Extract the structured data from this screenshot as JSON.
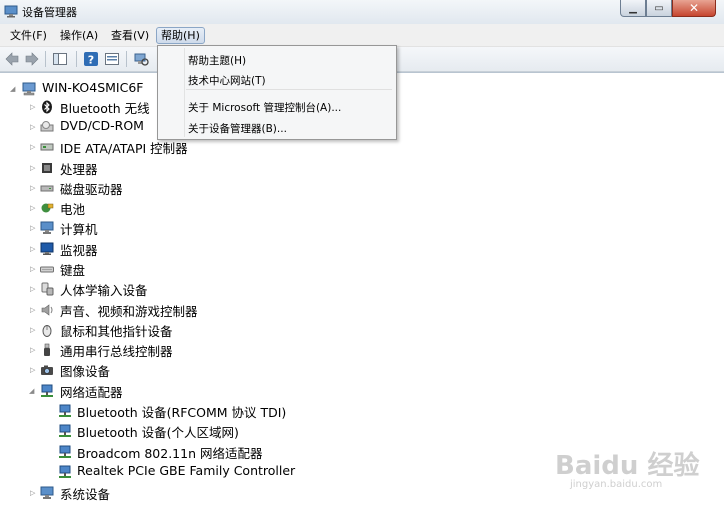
{
  "window": {
    "title": "设备管理器"
  },
  "menubar": {
    "items": [
      {
        "label": "文件(F)"
      },
      {
        "label": "操作(A)"
      },
      {
        "label": "查看(V)"
      },
      {
        "label": "帮助(H)"
      }
    ]
  },
  "help_menu": {
    "items": [
      {
        "label": "帮助主题(H)"
      },
      {
        "label": "技术中心网站(T)"
      },
      {
        "label": "关于 Microsoft 管理控制台(A)..."
      },
      {
        "label": "关于设备管理器(B)..."
      }
    ]
  },
  "tree": {
    "root": {
      "label": "WIN-KO4SMIC6F"
    },
    "categories": [
      {
        "label": "Bluetooth 无线",
        "icon": "bluetooth-icon"
      },
      {
        "label": "DVD/CD-ROM",
        "icon": "dvd-drive-icon"
      },
      {
        "label": "IDE ATA/ATAPI 控制器",
        "icon": "ide-controller-icon"
      },
      {
        "label": "处理器",
        "icon": "processor-icon"
      },
      {
        "label": "磁盘驱动器",
        "icon": "disk-drive-icon"
      },
      {
        "label": "电池",
        "icon": "battery-icon"
      },
      {
        "label": "计算机",
        "icon": "computer-icon"
      },
      {
        "label": "监视器",
        "icon": "monitor-icon"
      },
      {
        "label": "键盘",
        "icon": "keyboard-icon"
      },
      {
        "label": "人体学输入设备",
        "icon": "hid-icon"
      },
      {
        "label": "声音、视频和游戏控制器",
        "icon": "speaker-icon"
      },
      {
        "label": "鼠标和其他指针设备",
        "icon": "mouse-icon"
      },
      {
        "label": "通用串行总线控制器",
        "icon": "usb-icon"
      },
      {
        "label": "图像设备",
        "icon": "camera-icon"
      },
      {
        "label": "网络适配器",
        "icon": "network-adapter-icon"
      }
    ],
    "network_children": [
      {
        "label": "Bluetooth 设备(RFCOMM 协议 TDI)"
      },
      {
        "label": "Bluetooth 设备(个人区域网)"
      },
      {
        "label": "Broadcom 802.11n 网络适配器"
      },
      {
        "label": "Realtek PCIe GBE Family Controller"
      }
    ],
    "last": {
      "label": "系统设备",
      "icon": "system-devices-icon"
    }
  },
  "watermark": {
    "logo": "Baidu 经验",
    "url": "jingyan.baidu.com"
  }
}
